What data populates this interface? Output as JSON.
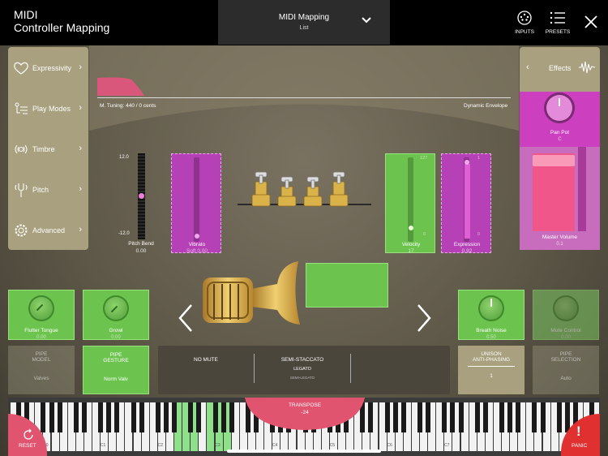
{
  "header": {
    "app_title_line1": "MIDI",
    "app_title_line2": "Controller Mapping",
    "mapping_title": "MIDI Mapping",
    "mapping_sub": "List",
    "inputs_label": "INPUTS",
    "presets_label": "PRESETS"
  },
  "left_menu": {
    "items": [
      {
        "label": "Expressivity",
        "icon": "heart-icon"
      },
      {
        "label": "Play Modes",
        "icon": "play-modes-icon"
      },
      {
        "label": "Timbre",
        "icon": "timbre-icon"
      },
      {
        "label": "Pitch",
        "icon": "pitch-icon"
      },
      {
        "label": "Advanced",
        "icon": "gear-icon"
      }
    ]
  },
  "effects": {
    "label": "Effects",
    "pan_label": "Pan Pot",
    "pan_value": "C",
    "volume_label": "Master Volume",
    "volume_value": "0.1"
  },
  "envelope": {
    "tuning": "M. Tuning: 440    / 0 cents",
    "label": "Dynamic Envelope"
  },
  "pitch_bend": {
    "top": "12.0",
    "bottom": "-12.0",
    "label": "Pitch Bend",
    "value": "0.00"
  },
  "vibrato": {
    "label": "Vibrato",
    "value": "Soft 0.00"
  },
  "velocity": {
    "label": "Velocity",
    "value": "17",
    "top": "127",
    "bottom": "0"
  },
  "expression": {
    "label": "Expression",
    "value": "0.92",
    "top": "1",
    "bottom": "0"
  },
  "knobs": [
    {
      "label": "Flutter Tongue",
      "value": "0.00"
    },
    {
      "label": "Growl",
      "value": "0.00"
    },
    {
      "label": "Breath Noise",
      "value": "0.50"
    },
    {
      "label": "Mute Control",
      "value": "0.00"
    }
  ],
  "pipes": {
    "model_label_1": "PIPE",
    "model_label_2": "MODEL",
    "model_value": "Valves",
    "gesture_label_1": "PIPE",
    "gesture_label_2": "GESTURE",
    "gesture_value": "Norm Valv",
    "unison_label_1": "UNISON",
    "unison_label_2": "ANTI-PHASING",
    "unison_value": "1",
    "selection_label_1": "PIPE",
    "selection_label_2": "SELECTION",
    "selection_value": "Auto"
  },
  "articulation": {
    "mute": "NO MUTE",
    "main": "SEMI-STACCATO",
    "sub1": "LEGATO",
    "sub2": "SEMI-LEGATO"
  },
  "transpose": {
    "label": "TRANSPOSE",
    "value": "-24"
  },
  "keyboard": {
    "octaves": [
      "C0",
      "C1",
      "C2",
      "C3",
      "C4",
      "C5",
      "C6",
      "C7"
    ]
  },
  "buttons": {
    "reset": "RESET",
    "panic": "PANIC"
  },
  "colors": {
    "green": "#6cc44f",
    "magenta": "#c040c0",
    "pink": "#e05a7a",
    "red": "#e03030"
  }
}
